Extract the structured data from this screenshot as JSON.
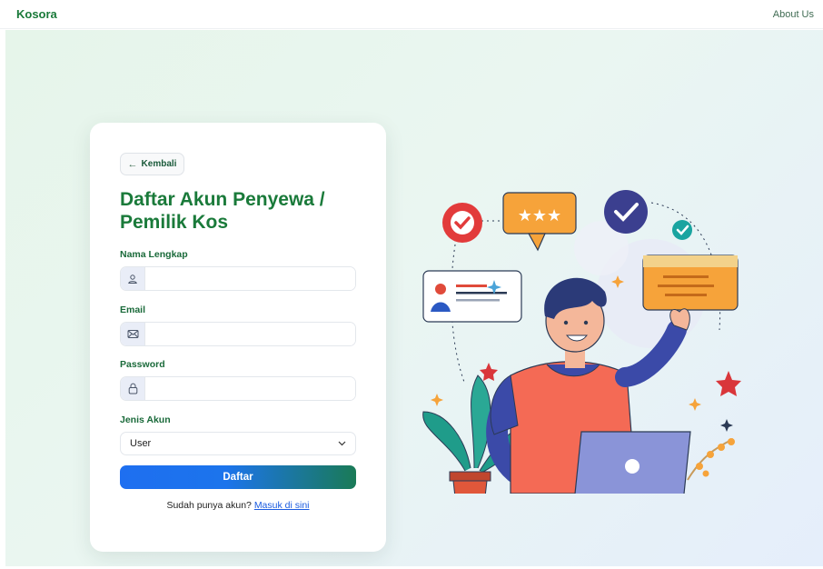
{
  "nav": {
    "brand": "Kosora",
    "about_label": "About Us"
  },
  "form": {
    "back_label": "Kembali",
    "back_arrow": "←",
    "title": "Daftar Akun Penyewa / Pemilik Kos",
    "fields": {
      "name_label": "Nama Lengkap",
      "name_value": "",
      "email_label": "Email",
      "email_value": "",
      "password_label": "Password",
      "password_value": "",
      "account_type_label": "Jenis Akun",
      "account_type_value": "User"
    },
    "icons": {
      "name": "user-icon",
      "email": "envelope-icon",
      "password": "lock-icon",
      "select": "chevron-down-icon"
    },
    "submit_label": "Daftar",
    "login_prompt": "Sudah punya akun?",
    "login_link": "Masuk di sini"
  },
  "colors": {
    "brand_green": "#1a7a3a",
    "button_blue": "#1e6ff0",
    "link_blue": "#1a5be0"
  }
}
